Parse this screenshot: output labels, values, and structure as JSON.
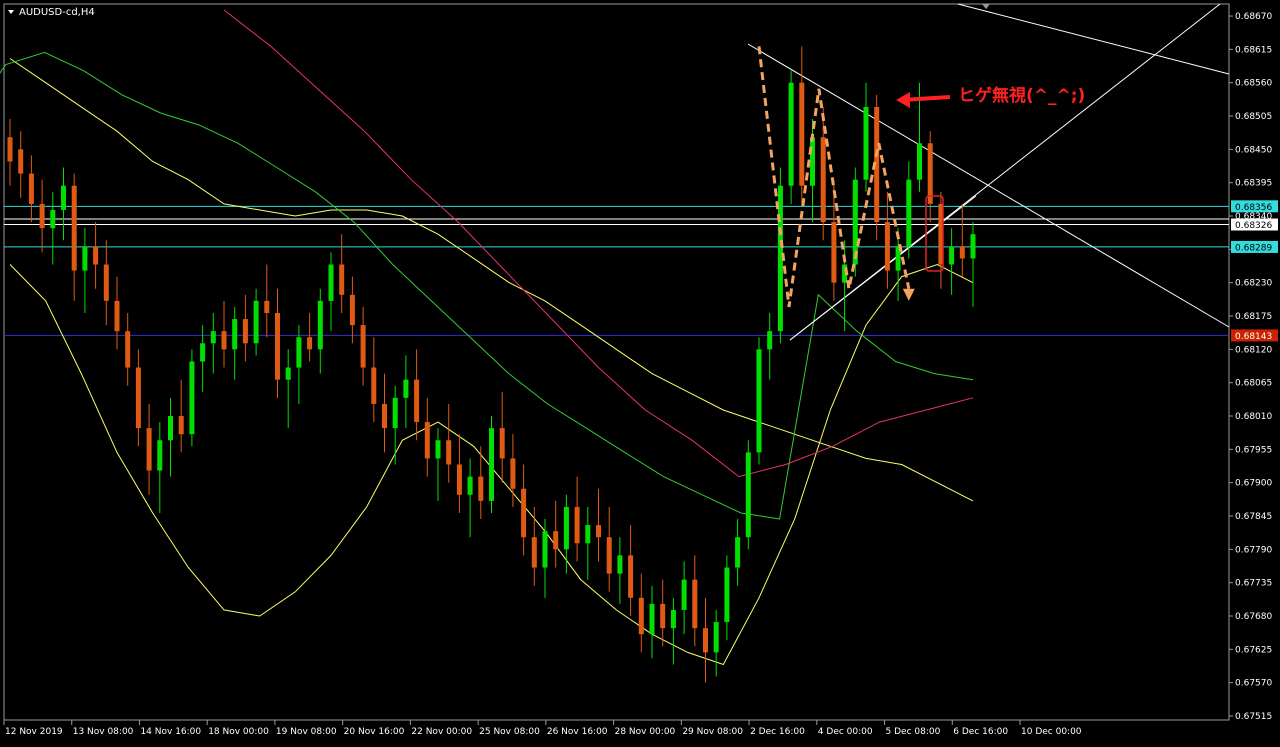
{
  "window": {
    "symbol_title": "AUDUSD-cd,H4"
  },
  "annotation": {
    "text": "ヒゲ無視(^_^;)"
  },
  "colors": {
    "background": "#000000",
    "bull_candle": "#00e000",
    "bear_candle": "#e05a14",
    "bollinger": "#ffff66",
    "ma_green": "#33cc33",
    "ma_magenta": "#e6336e",
    "trendline": "#ffffff",
    "hline_cyan": "#33dddd",
    "hline_white": "#ffffff",
    "hline_red": "#cc2200",
    "zigzag": "#f4a460",
    "annotation": "#ff2020"
  },
  "chart_data": {
    "type": "candlestick",
    "ylim": [
      0.67515,
      0.68675
    ],
    "y_ticks": [
      "0.68670",
      "0.68615",
      "0.68560",
      "0.68505",
      "0.68450",
      "0.68395",
      "0.68340",
      "0.68285",
      "0.68230",
      "0.68175",
      "0.68120",
      "0.68065",
      "0.68010",
      "0.67955",
      "0.67900",
      "0.67845",
      "0.67790",
      "0.67735",
      "0.67680",
      "0.67625",
      "0.67570",
      "0.67515"
    ],
    "x_labels": [
      "12 Nov 2019",
      "13 Nov 08:00",
      "14 Nov 16:00",
      "18 Nov 00:00",
      "19 Nov 08:00",
      "20 Nov 16:00",
      "22 Nov 00:00",
      "25 Nov 08:00",
      "26 Nov 16:00",
      "28 Nov 00:00",
      "29 Nov 08:00",
      "2 Dec 16:00",
      "4 Dec 00:00",
      "5 Dec 08:00",
      "6 Dec 16:00",
      "10 Dec 00:00"
    ],
    "price_tags": [
      {
        "value": 0.68356,
        "label": "0.68356",
        "color": "cyan"
      },
      {
        "value": 0.68326,
        "label": "0.68326",
        "color": "white"
      },
      {
        "value": 0.68289,
        "label": "0.68289",
        "color": "cyan"
      },
      {
        "value": 0.68143,
        "label": "0.68143",
        "color": "red"
      }
    ],
    "candles": [
      [
        0.6847,
        0.685,
        0.6839,
        0.6843
      ],
      [
        0.6845,
        0.6848,
        0.6837,
        0.6841
      ],
      [
        0.6841,
        0.6844,
        0.6833,
        0.6836
      ],
      [
        0.6836,
        0.684,
        0.6828,
        0.6832
      ],
      [
        0.6832,
        0.6838,
        0.6826,
        0.6835
      ],
      [
        0.6835,
        0.6842,
        0.683,
        0.6839
      ],
      [
        0.6839,
        0.6841,
        0.682,
        0.6825
      ],
      [
        0.6825,
        0.6832,
        0.6818,
        0.6829
      ],
      [
        0.6829,
        0.6833,
        0.6822,
        0.6826
      ],
      [
        0.6826,
        0.683,
        0.6816,
        0.682
      ],
      [
        0.682,
        0.6824,
        0.6812,
        0.6815
      ],
      [
        0.6815,
        0.6818,
        0.6806,
        0.6809
      ],
      [
        0.6809,
        0.6812,
        0.6796,
        0.6799
      ],
      [
        0.6799,
        0.6803,
        0.6788,
        0.6792
      ],
      [
        0.6792,
        0.68,
        0.6785,
        0.6797
      ],
      [
        0.6797,
        0.6804,
        0.6791,
        0.6801
      ],
      [
        0.6801,
        0.6807,
        0.6795,
        0.6798
      ],
      [
        0.6798,
        0.6812,
        0.6796,
        0.681
      ],
      [
        0.681,
        0.6816,
        0.6805,
        0.6813
      ],
      [
        0.6813,
        0.6818,
        0.6808,
        0.6815
      ],
      [
        0.6815,
        0.682,
        0.6809,
        0.6812
      ],
      [
        0.6812,
        0.6819,
        0.6807,
        0.6817
      ],
      [
        0.6817,
        0.6821,
        0.681,
        0.6813
      ],
      [
        0.6813,
        0.6822,
        0.6811,
        0.682
      ],
      [
        0.682,
        0.6826,
        0.6814,
        0.6818
      ],
      [
        0.6818,
        0.6822,
        0.6804,
        0.6807
      ],
      [
        0.6807,
        0.6812,
        0.6799,
        0.6809
      ],
      [
        0.6809,
        0.6816,
        0.6803,
        0.6814
      ],
      [
        0.6814,
        0.6818,
        0.681,
        0.6812
      ],
      [
        0.6812,
        0.6822,
        0.6808,
        0.682
      ],
      [
        0.682,
        0.6828,
        0.6815,
        0.6826
      ],
      [
        0.6826,
        0.6831,
        0.6818,
        0.6821
      ],
      [
        0.6821,
        0.6824,
        0.6813,
        0.6816
      ],
      [
        0.6816,
        0.6819,
        0.6806,
        0.6809
      ],
      [
        0.6809,
        0.6814,
        0.68,
        0.6803
      ],
      [
        0.6803,
        0.6808,
        0.6795,
        0.6799
      ],
      [
        0.6799,
        0.6806,
        0.6793,
        0.6804
      ],
      [
        0.6804,
        0.6811,
        0.6799,
        0.6807
      ],
      [
        0.6807,
        0.6812,
        0.6797,
        0.68
      ],
      [
        0.68,
        0.6804,
        0.6791,
        0.6794
      ],
      [
        0.6794,
        0.6799,
        0.6787,
        0.6797
      ],
      [
        0.6797,
        0.6803,
        0.679,
        0.6793
      ],
      [
        0.6793,
        0.6798,
        0.6785,
        0.6788
      ],
      [
        0.6788,
        0.6794,
        0.6781,
        0.6791
      ],
      [
        0.6791,
        0.6796,
        0.6784,
        0.6787
      ],
      [
        0.6787,
        0.6801,
        0.6785,
        0.6799
      ],
      [
        0.6799,
        0.6805,
        0.679,
        0.6794
      ],
      [
        0.6794,
        0.6798,
        0.6786,
        0.6789
      ],
      [
        0.6789,
        0.6793,
        0.6778,
        0.6781
      ],
      [
        0.6781,
        0.6786,
        0.6773,
        0.6776
      ],
      [
        0.6776,
        0.6784,
        0.6771,
        0.6782
      ],
      [
        0.6782,
        0.6787,
        0.6776,
        0.6779
      ],
      [
        0.6779,
        0.6788,
        0.6775,
        0.6786
      ],
      [
        0.6786,
        0.6791,
        0.6777,
        0.678
      ],
      [
        0.678,
        0.6786,
        0.6774,
        0.6783
      ],
      [
        0.6783,
        0.6789,
        0.6777,
        0.6781
      ],
      [
        0.6781,
        0.6786,
        0.6772,
        0.6775
      ],
      [
        0.6775,
        0.6781,
        0.677,
        0.6778
      ],
      [
        0.6778,
        0.6783,
        0.6768,
        0.6771
      ],
      [
        0.6771,
        0.6775,
        0.6762,
        0.6765
      ],
      [
        0.6765,
        0.6773,
        0.6761,
        0.677
      ],
      [
        0.677,
        0.6774,
        0.6763,
        0.6766
      ],
      [
        0.6766,
        0.6771,
        0.676,
        0.6769
      ],
      [
        0.6769,
        0.6777,
        0.6765,
        0.6774
      ],
      [
        0.6774,
        0.6778,
        0.6763,
        0.6766
      ],
      [
        0.6766,
        0.6771,
        0.6757,
        0.6762
      ],
      [
        0.6762,
        0.6769,
        0.6758,
        0.6767
      ],
      [
        0.6767,
        0.6778,
        0.6764,
        0.6776
      ],
      [
        0.6776,
        0.6784,
        0.6773,
        0.6781
      ],
      [
        0.6781,
        0.6797,
        0.6779,
        0.6795
      ],
      [
        0.6795,
        0.6814,
        0.6793,
        0.6812
      ],
      [
        0.6812,
        0.6818,
        0.6807,
        0.6815
      ],
      [
        0.6815,
        0.6842,
        0.6813,
        0.6839
      ],
      [
        0.6839,
        0.6858,
        0.6836,
        0.6856
      ],
      [
        0.6856,
        0.6862,
        0.6836,
        0.6839
      ],
      [
        0.6839,
        0.685,
        0.6833,
        0.6847
      ],
      [
        0.6847,
        0.6852,
        0.683,
        0.6833
      ],
      [
        0.6833,
        0.684,
        0.682,
        0.6823
      ],
      [
        0.6823,
        0.683,
        0.6815,
        0.6826
      ],
      [
        0.6826,
        0.6842,
        0.6824,
        0.684
      ],
      [
        0.684,
        0.6856,
        0.6838,
        0.6852
      ],
      [
        0.6852,
        0.6854,
        0.683,
        0.6833
      ],
      [
        0.6833,
        0.6838,
        0.6822,
        0.6825
      ],
      [
        0.6825,
        0.6832,
        0.682,
        0.6829
      ],
      [
        0.6829,
        0.6843,
        0.6827,
        0.684
      ],
      [
        0.684,
        0.6856,
        0.6838,
        0.6846
      ],
      [
        0.6846,
        0.6848,
        0.6833,
        0.6836
      ],
      [
        0.6836,
        0.6838,
        0.6822,
        0.6826
      ],
      [
        0.6826,
        0.6832,
        0.6821,
        0.6829
      ],
      [
        0.6829,
        0.6836,
        0.6824,
        0.6827
      ],
      [
        0.6827,
        0.6833,
        0.6819,
        0.6831
      ]
    ],
    "bollinger_upper": [
      0.686,
      0.6856,
      0.6852,
      0.6848,
      0.6843,
      0.684,
      0.6836,
      0.6835,
      0.6834,
      0.6835,
      0.6835,
      0.6834,
      0.6831,
      0.6827,
      0.6823,
      0.682,
      0.6816,
      0.6812,
      0.6808,
      0.6805,
      0.6802,
      0.68,
      0.6798,
      0.6796,
      0.6794,
      0.6793,
      0.679,
      0.6787
    ],
    "bollinger_lower": [
      0.6826,
      0.682,
      0.6808,
      0.6795,
      0.6785,
      0.6776,
      0.6769,
      0.6768,
      0.6772,
      0.6778,
      0.6786,
      0.6797,
      0.68,
      0.6796,
      0.6789,
      0.6782,
      0.6774,
      0.6769,
      0.6765,
      0.6762,
      0.676,
      0.6771,
      0.6784,
      0.6802,
      0.6816,
      0.6824,
      0.6826,
      0.6823
    ],
    "ma_green": [
      0.685,
      0.6859,
      0.6861,
      0.6858,
      0.6854,
      0.6851,
      0.6849,
      0.6846,
      0.6842,
      0.6838,
      0.6833,
      0.6826,
      0.682,
      0.6814,
      0.6808,
      0.6803,
      0.6799,
      0.6795,
      0.6791,
      0.6788,
      0.6785,
      0.6784,
      0.6821,
      0.6815,
      0.681,
      0.6808,
      0.6807
    ],
    "ma_magenta": [
      0.6868,
      0.6862,
      0.6855,
      0.6848,
      0.684,
      0.6833,
      0.6825,
      0.6817,
      0.6809,
      0.6802,
      0.6797,
      0.6791,
      0.6793,
      0.6796,
      0.68,
      0.6802,
      0.6804
    ],
    "hlines": [
      0.68356,
      0.68326,
      0.68289,
      0.68143
    ],
    "zigzag_points": [
      0.6862,
      0.6819,
      0.6855,
      0.6822,
      0.6846,
      0.6822
    ]
  }
}
